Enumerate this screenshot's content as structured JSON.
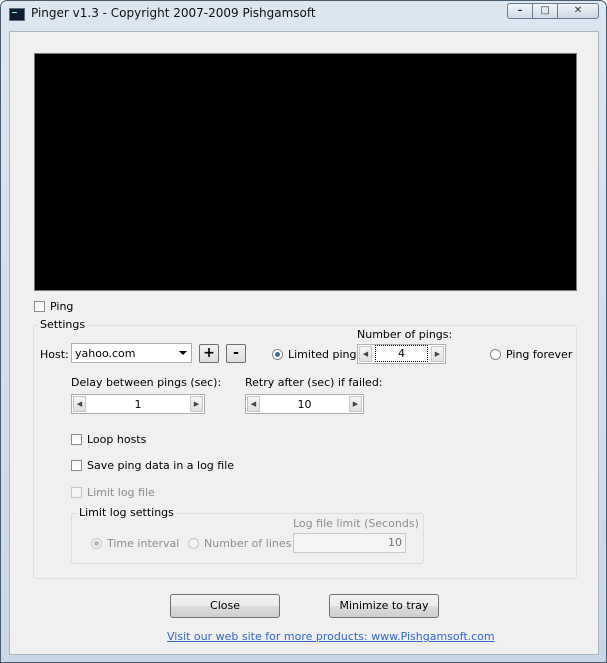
{
  "window": {
    "title": "Pinger v1.3 - Copyright 2007-2009 Pishgamsoft",
    "icon": "console-app-icon",
    "caption": {
      "minimize_glyph": "–",
      "maximize_glyph": "□",
      "close_glyph": "✕"
    }
  },
  "ping_checkbox": {
    "label": "Ping",
    "checked": false
  },
  "settings": {
    "legend": "Settings",
    "host": {
      "label": "Host:",
      "value": "yahoo.com"
    },
    "add_button": "+",
    "remove_button": "-",
    "limited_ping": {
      "label": "Limited ping",
      "selected": true
    },
    "number_of_pings": {
      "label": "Number of pings:",
      "value": "4"
    },
    "ping_forever": {
      "label": "Ping forever",
      "selected": false
    },
    "delay": {
      "label": "Delay between pings (sec):",
      "value": "1"
    },
    "retry": {
      "label": "Retry after (sec) if failed:",
      "value": "10"
    },
    "loop_hosts": {
      "label": "Loop hosts",
      "checked": false
    },
    "save_log": {
      "label": "Save ping data in a log file",
      "checked": false
    },
    "limit_log": {
      "label": "Limit log file",
      "checked": false,
      "enabled": false
    },
    "limit_log_settings": {
      "legend": "Limit log settings",
      "time_interval": {
        "label": "Time interval",
        "selected": true
      },
      "number_of_lines": {
        "label": "Number of lines",
        "selected": false
      },
      "log_limit": {
        "label": "Log file limit (Seconds)",
        "value": "10"
      }
    }
  },
  "buttons": {
    "close": "Close",
    "minimize": "Minimize to tray"
  },
  "footer_link": "Visit our web site for more products: www.Pishgamsoft.com",
  "colors": {
    "console_bg": "#000000",
    "link": "#3366cc",
    "accent_radio": "#3a6ea5"
  }
}
